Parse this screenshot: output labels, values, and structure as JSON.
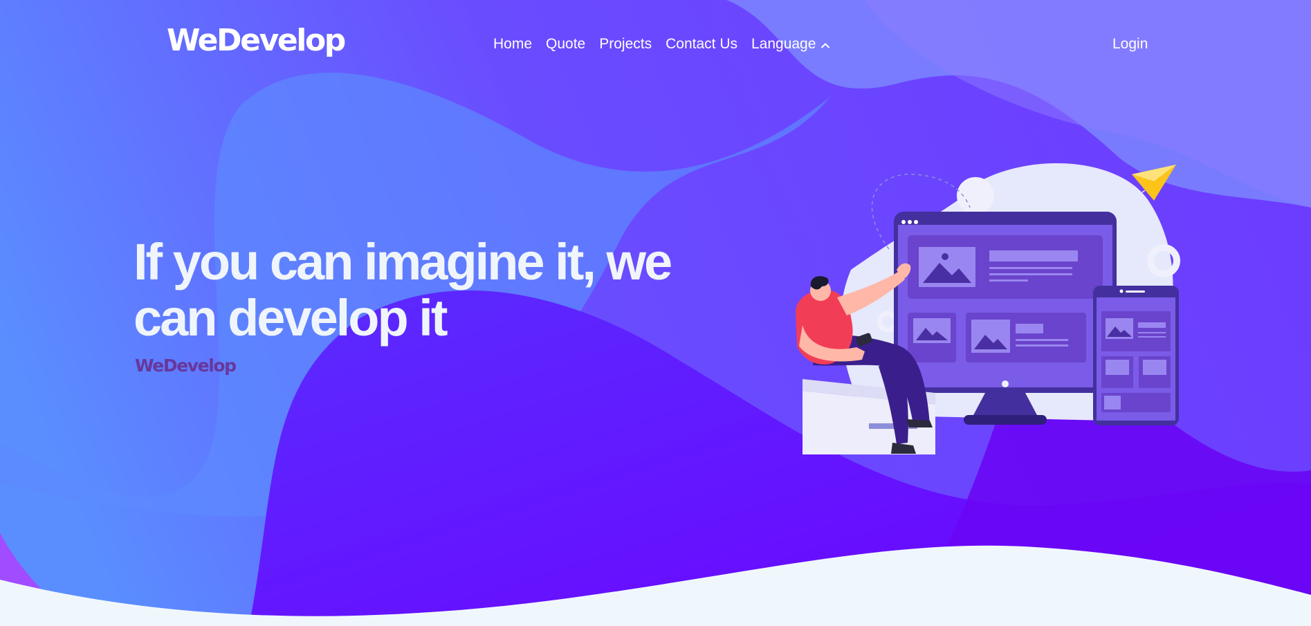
{
  "header": {
    "brand": "WeDevelop",
    "nav": [
      {
        "label": "Home"
      },
      {
        "label": "Quote"
      },
      {
        "label": "Projects"
      },
      {
        "label": "Contact Us"
      },
      {
        "label": "Language",
        "icon": "chevron-up-icon"
      }
    ],
    "login": "Login"
  },
  "hero": {
    "title": "If you can imagine it, we can develop it",
    "subtitle": "WeDevelop",
    "illustration": "person-with-desktop-and-tablet-illustration"
  },
  "colors": {
    "gradient_light": "#5a8cff",
    "gradient_mid": "#6a3dff",
    "gradient_deep": "#6a00ff",
    "page_bottom": "#f0f7fc",
    "subtitle": "#68379c",
    "shirt": "#f23d57",
    "paper_plane": "#fcc419"
  }
}
